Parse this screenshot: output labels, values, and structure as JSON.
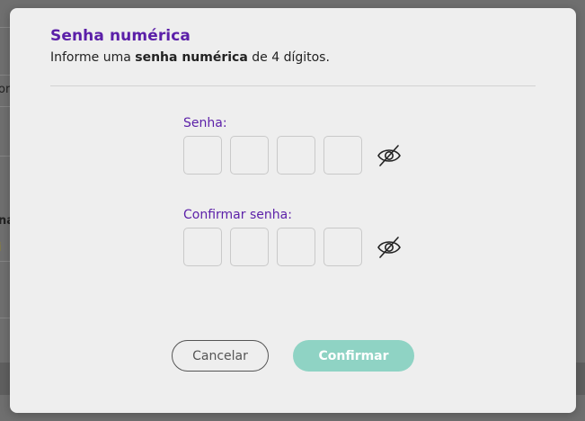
{
  "background": {
    "fragments": [
      "or",
      "na",
      "i"
    ]
  },
  "modal": {
    "title": "Senha numérica",
    "subtitle_prefix": "Informe uma ",
    "subtitle_bold": "senha numérica",
    "subtitle_suffix": " de 4 dígitos."
  },
  "fields": [
    {
      "label": "Senha:",
      "digits": [
        "",
        "",
        "",
        ""
      ],
      "visibility_icon": "eye-slash-icon"
    },
    {
      "label": "Confirmar senha:",
      "digits": [
        "",
        "",
        "",
        ""
      ],
      "visibility_icon": "eye-slash-icon"
    }
  ],
  "actions": {
    "cancel_label": "Cancelar",
    "confirm_label": "Confirmar"
  },
  "colors": {
    "accent": "#5b1fa8",
    "confirm_bg": "#8fd3c4",
    "overlay": "#6f6f6f"
  }
}
